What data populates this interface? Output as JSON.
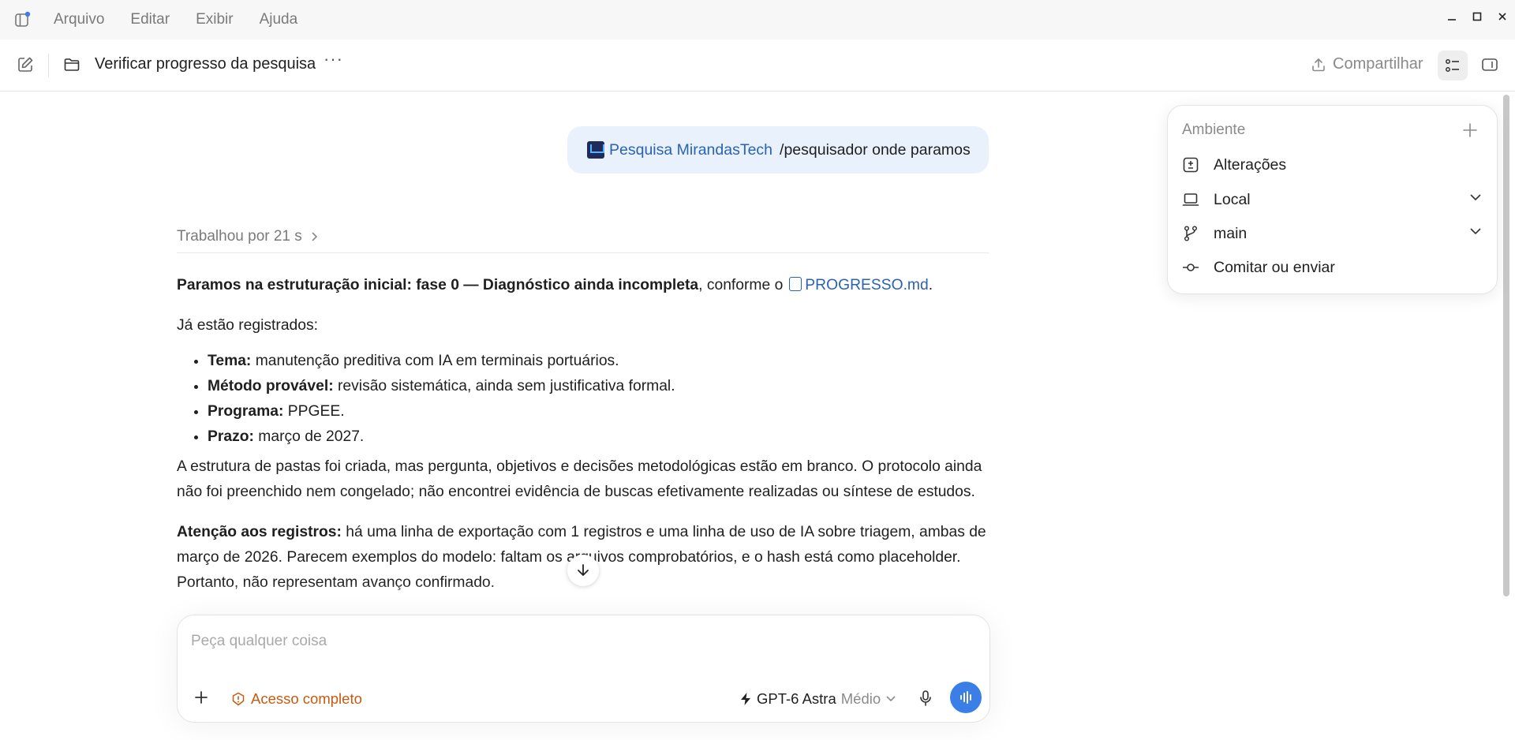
{
  "menubar": {
    "items": [
      "Arquivo",
      "Editar",
      "Exibir",
      "Ajuda"
    ],
    "window_controls": [
      "–",
      "□",
      "×"
    ]
  },
  "titlebar": {
    "title": "Verificar progresso da pesquisa",
    "more": "···",
    "share_label": "Compartilhar"
  },
  "user_message": {
    "project": "Pesquisa MirandasTech",
    "command": "/pesquisador onde paramos"
  },
  "worked": {
    "label": "Trabalhou por 21 s"
  },
  "response": {
    "p1_bold": "Paramos na estruturação inicial: fase 0 — Diagnóstico ainda incompleta",
    "p1_rest": ", conforme o",
    "p1_file": "PROGRESSO.md",
    "p1_end": ".",
    "p2": "Já estão registrados:",
    "bullets": [
      {
        "label": "Tema:",
        "text": " manutenção preditiva com IA em terminais portuários."
      },
      {
        "label": "Método provável:",
        "text": " revisão sistemática, ainda sem justificativa formal."
      },
      {
        "label": "Programa:",
        "text": " PPGEE."
      },
      {
        "label": "Prazo:",
        "text": " março de 2027."
      }
    ],
    "p3": "A estrutura de pastas foi criada, mas pergunta, objetivos e decisões metodológicas estão em branco. O protocolo ainda não foi preenchido nem congelado; não encontrei evidência de buscas efetivamente realizadas ou síntese de estudos.",
    "p4_bold": "Atenção aos registros:",
    "p4_rest": " há uma linha de exportação com 1 registros e uma linha de uso de IA sobre triagem, ambas de março de 2026. Parecem exemplos do modelo: faltam os arquivos comprobatórios, e o hash está como placeholder. Portanto, não representam avanço confirmado."
  },
  "composer": {
    "placeholder": "Peça qualquer coisa",
    "access_label": "Acesso completo",
    "model_name": "GPT-6 Astra",
    "model_level": "Médio"
  },
  "environment": {
    "title": "Ambiente",
    "rows": [
      {
        "label": "Alterações",
        "icon": "diff-icon"
      },
      {
        "label": "Local",
        "icon": "laptop-icon"
      },
      {
        "label": "main",
        "icon": "branch-icon"
      },
      {
        "label": "Comitar ou enviar",
        "icon": "commit-icon"
      }
    ]
  },
  "colors": {
    "accent": "#3b7fe6",
    "link": "#2a62b5",
    "warning": "#c65a10",
    "bubble": "#e8f1fc"
  }
}
